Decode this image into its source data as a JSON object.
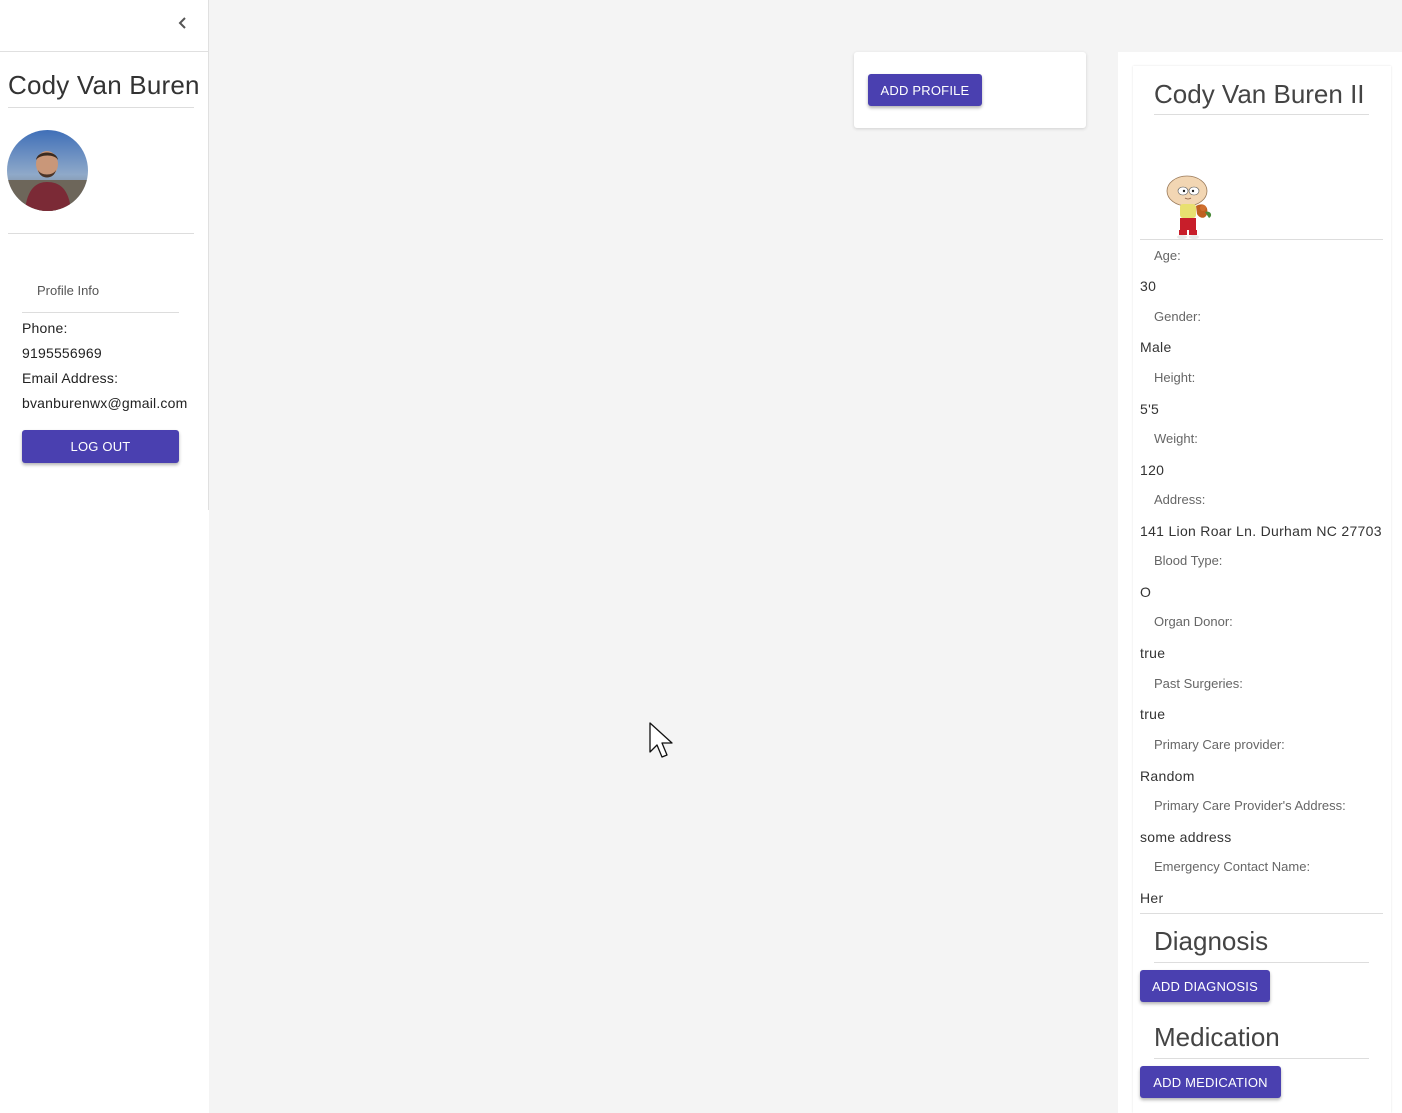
{
  "sidebar": {
    "collapse_icon": "chevron-left-icon",
    "user_name": "Cody Van Buren",
    "profile_info_label": "Profile Info",
    "phone_label": "Phone:",
    "phone_value": "9195556969",
    "email_label": "Email Address:",
    "email_value": "bvanburenwx@gmail.com",
    "logout_label": "LOG OUT"
  },
  "main": {
    "add_profile_label": "ADD PROFILE"
  },
  "profile": {
    "title": "Cody Van Buren II",
    "fields": [
      {
        "label": "Age:",
        "value": "30"
      },
      {
        "label": "Gender:",
        "value": "Male"
      },
      {
        "label": "Height:",
        "value": "5'5"
      },
      {
        "label": "Weight:",
        "value": "120"
      },
      {
        "label": "Address:",
        "value": "141 Lion Roar Ln. Durham NC 27703"
      },
      {
        "label": "Blood Type:",
        "value": "O"
      },
      {
        "label": "Organ Donor:",
        "value": "true"
      },
      {
        "label": "Past Surgeries:",
        "value": "true"
      },
      {
        "label": "Primary Care provider:",
        "value": "Random"
      },
      {
        "label": "Primary Care Provider's Address:",
        "value": "some address"
      },
      {
        "label": "Emergency Contact Name:",
        "value": "Her"
      }
    ],
    "diagnosis_title": "Diagnosis",
    "add_diagnosis_label": "ADD DIAGNOSIS",
    "medication_title": "Medication",
    "add_medication_label": "ADD MEDICATION"
  },
  "colors": {
    "primary_button": "#4a40b0",
    "background": "#f4f4f4"
  }
}
